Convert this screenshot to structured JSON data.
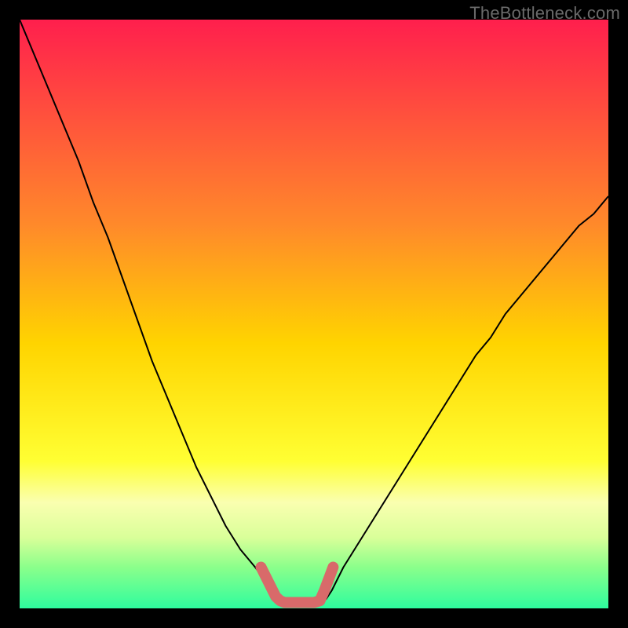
{
  "watermark": "TheBottleneck.com",
  "chart_data": {
    "type": "line",
    "title": "",
    "xlabel": "",
    "ylabel": "",
    "xlim": [
      -10,
      10
    ],
    "ylim": [
      0,
      100
    ],
    "grid": false,
    "legend": false,
    "background": {
      "type": "vertical-gradient",
      "stops": [
        {
          "pos": 0.0,
          "color": "#ff1f4d"
        },
        {
          "pos": 0.35,
          "color": "#ff8a2a"
        },
        {
          "pos": 0.55,
          "color": "#ffd400"
        },
        {
          "pos": 0.75,
          "color": "#ffff33"
        },
        {
          "pos": 0.82,
          "color": "#faffb0"
        },
        {
          "pos": 0.88,
          "color": "#d9ff99"
        },
        {
          "pos": 0.93,
          "color": "#8bff8b"
        },
        {
          "pos": 1.0,
          "color": "#2efc9e"
        }
      ]
    },
    "series": [
      {
        "name": "left_curve",
        "stroke": "#000000",
        "stroke_width": 2,
        "x": [
          -10.0,
          -9.5,
          -9.0,
          -8.5,
          -8.0,
          -7.5,
          -7.0,
          -6.5,
          -6.0,
          -5.5,
          -5.0,
          -4.5,
          -4.0,
          -3.5,
          -3.0,
          -2.5,
          -2.0,
          -1.7,
          -1.5,
          -1.3,
          -1.1
        ],
        "values": [
          100,
          94,
          88,
          82,
          76,
          69,
          63,
          56,
          49,
          42,
          36,
          30,
          24,
          19,
          14,
          10,
          7,
          5,
          4,
          2.5,
          1.5
        ]
      },
      {
        "name": "right_curve",
        "stroke": "#000000",
        "stroke_width": 2,
        "x": [
          0.4,
          0.6,
          0.8,
          1.0,
          1.5,
          2.0,
          2.5,
          3.0,
          3.5,
          4.0,
          4.5,
          5.0,
          5.5,
          6.0,
          6.5,
          7.0,
          7.5,
          8.0,
          8.5,
          9.0,
          9.5,
          10.0
        ],
        "values": [
          1.5,
          3,
          5,
          7,
          11,
          15,
          19,
          23,
          27,
          31,
          35,
          39,
          43,
          46,
          50,
          53,
          56,
          59,
          62,
          65,
          67,
          70
        ]
      },
      {
        "name": "bottleneck_highlight",
        "stroke": "#d86a6a",
        "stroke_width": 14,
        "linecap": "round",
        "x": [
          -1.8,
          -1.5,
          -1.3,
          -1.15,
          -1.0,
          -0.5,
          0.0,
          0.2,
          0.35,
          0.5,
          0.65
        ],
        "values": [
          7.0,
          4.0,
          2.0,
          1.3,
          1.0,
          1.0,
          1.0,
          1.3,
          3.0,
          5.0,
          7.0
        ]
      }
    ]
  }
}
